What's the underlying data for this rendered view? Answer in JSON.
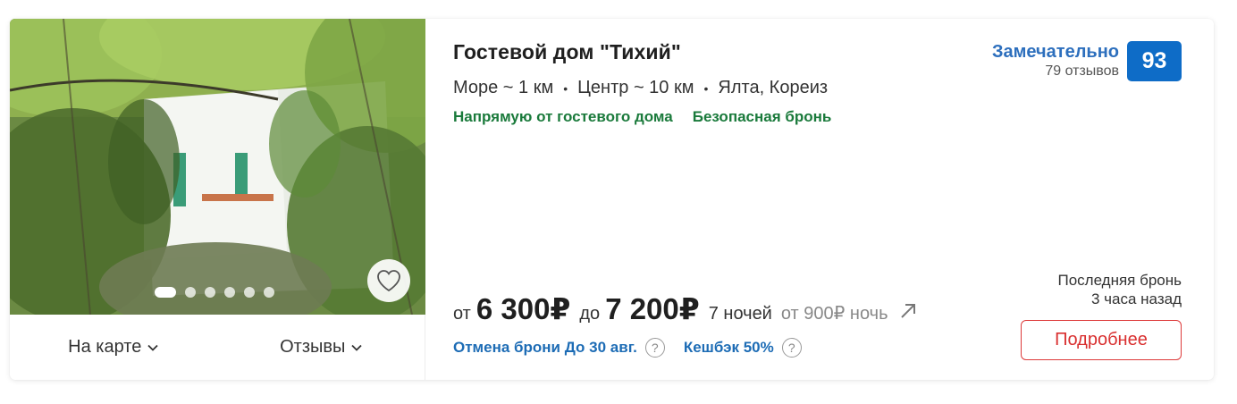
{
  "hotel": {
    "title": "Гостевой дом \"Тихий\"",
    "location": {
      "sea": "Море ~ 1 км",
      "center": "Центр ~ 10 км",
      "city": "Ялта, Кореиз"
    },
    "tags": [
      "Напрямую от гостевого дома",
      "Безопасная бронь"
    ]
  },
  "rating": {
    "word": "Замечательно",
    "reviews": "79 отзывов",
    "score": "93"
  },
  "photo": {
    "slides_total": 6,
    "active_slide": 1
  },
  "links": {
    "map": "На карте",
    "reviews": "Отзывы"
  },
  "price": {
    "from": "от",
    "from_value": "6 300₽",
    "to": "до",
    "to_value": "7 200₽",
    "nights": "7 ночей",
    "per_night_prefix": "от 900₽",
    "per_night_suffix": "ночь"
  },
  "offers": {
    "cancel": "Отмена брони До 30 авг.",
    "cashback": "Кешбэк 50%",
    "help_mark": "?"
  },
  "last_booking": {
    "line1": "Последняя бронь",
    "line2": "3 часа назад"
  },
  "buttons": {
    "details": "Подробнее"
  },
  "colors": {
    "accent_blue": "#0e6cc7",
    "green": "#1a7a3b",
    "red": "#dd3a3a"
  },
  "icons": {
    "favorite": "heart-icon",
    "chevron": "chevron-down-icon",
    "trend": "arrow-up-right-icon"
  }
}
